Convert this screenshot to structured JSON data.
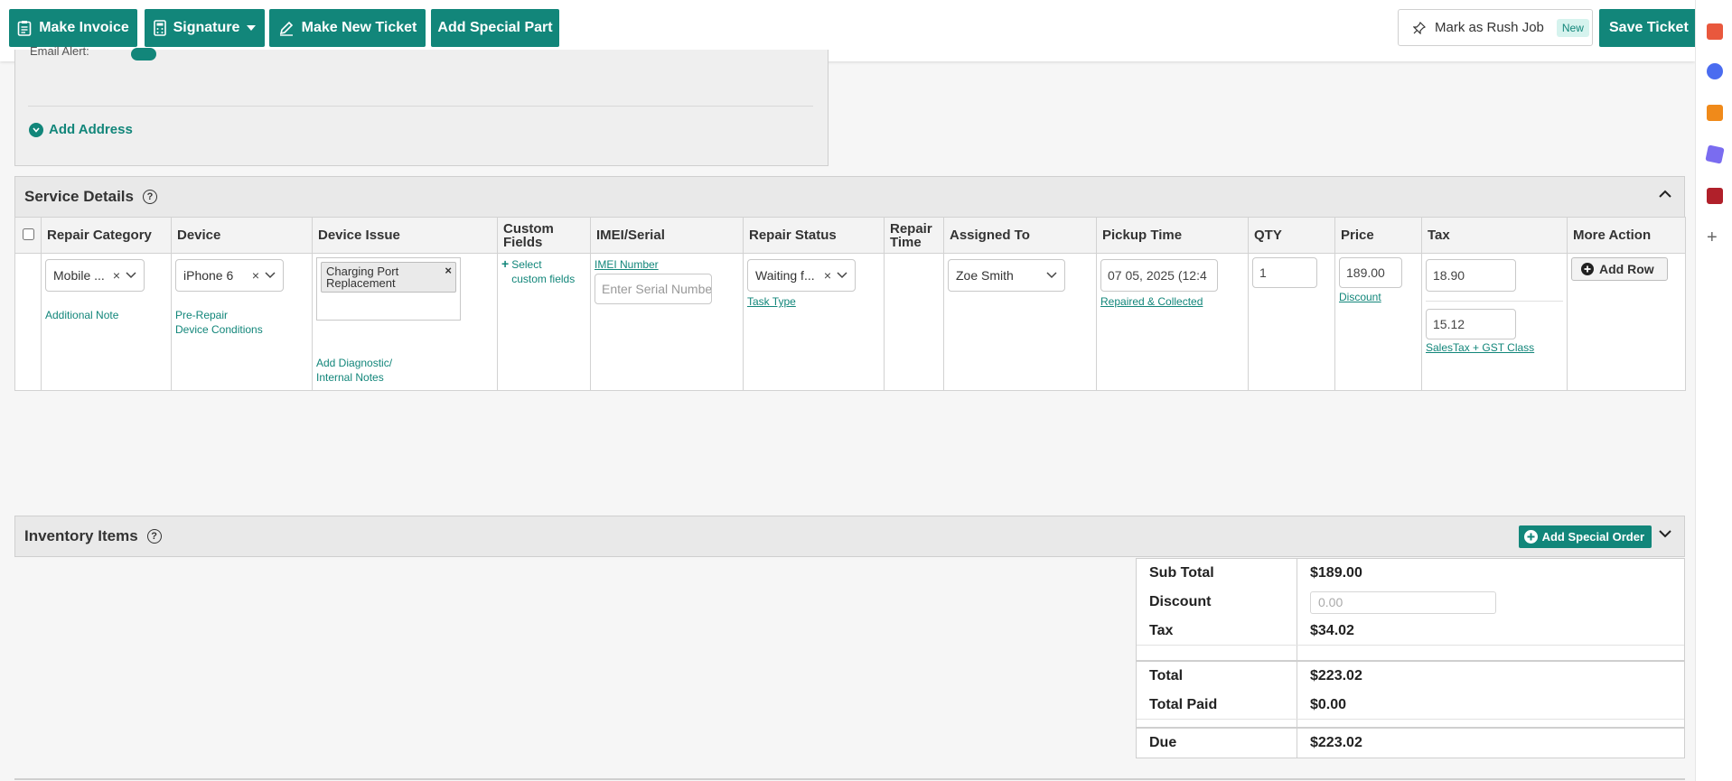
{
  "toolbar": {
    "make_invoice": "Make Invoice",
    "signature": "Signature",
    "make_new_ticket": "Make New Ticket",
    "add_special_part": "Add Special Part",
    "mark_rush_job": "Mark as Rush Job",
    "new_badge": "New",
    "save_ticket": "Save Ticket"
  },
  "customer": {
    "email_alert_label": "Email Alert:",
    "add_address": "Add Address"
  },
  "service_details": {
    "title": "Service Details",
    "columns": [
      "Repair Category",
      "Device",
      "Device Issue",
      "Custom Fields",
      "IMEI/Serial",
      "Repair Status",
      "Repair Time",
      "Assigned To",
      "Pickup Time",
      "QTY",
      "Price",
      "Tax",
      "More Action"
    ],
    "row": {
      "repair_category": "Mobile ...",
      "additional_note": "Additional Note",
      "device": "iPhone 6",
      "pre_repair_1": "Pre-Repair",
      "pre_repair_2": "Device Conditions",
      "device_issue_tag_1": "Charging Port",
      "device_issue_tag_2": "Replacement",
      "add_diag_1": "Add Diagnostic/",
      "add_diag_2": "Internal Notes",
      "custom_fields_1": "Select",
      "custom_fields_2": "custom fields",
      "imei_link": "IMEI Number",
      "serial_placeholder": "Enter Serial Number",
      "repair_status": "Waiting f...",
      "task_type": "Task Type",
      "assigned_to": "Zoe Smith",
      "pickup_time": "07 05, 2025 (12:4",
      "repaired_collected": "Repaired & Collected",
      "qty": "1",
      "price": "189.00",
      "discount_link": "Discount",
      "tax_1": "18.90",
      "tax_2": "15.12",
      "tax_class": "SalesTax + GST Class",
      "add_row": "Add Row"
    }
  },
  "inventory": {
    "title": "Inventory Items",
    "add_special_order": "Add Special Order"
  },
  "totals": {
    "sub_total_label": "Sub Total",
    "sub_total": "$189.00",
    "discount_label": "Discount",
    "discount_placeholder": "0.00",
    "tax_label": "Tax",
    "tax": "$34.02",
    "total_label": "Total",
    "total": "$223.02",
    "total_paid_label": "Total Paid",
    "total_paid": "$0.00",
    "due_label": "Due",
    "due": "$223.02"
  },
  "colors": {
    "accent": "#12867a",
    "header_bg": "#e9e9e9"
  }
}
